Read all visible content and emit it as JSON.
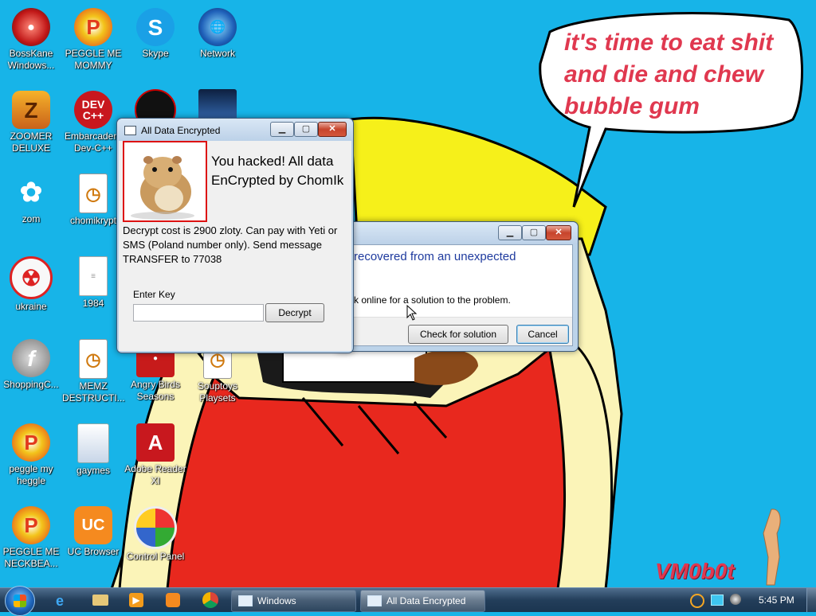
{
  "desktop": {
    "icons": [
      {
        "label": "BossKane Windows...",
        "icon": "bosskane-icon"
      },
      {
        "label": "PEGGLE ME MOMMY",
        "icon": "peggle-icon"
      },
      {
        "label": "Skype",
        "icon": "skype-icon"
      },
      {
        "label": "Network",
        "icon": "network-icon"
      },
      {
        "label": "ZOOMER DELUXE",
        "icon": "zoomer-icon"
      },
      {
        "label": "Embarcadero Dev-C++",
        "icon": "devcpp-icon"
      },
      {
        "label": "zom",
        "icon": "flower-icon"
      },
      {
        "label": "chomikrypt",
        "icon": "lock-file-icon"
      },
      {
        "label": "ukraine",
        "icon": "radiation-icon"
      },
      {
        "label": "1984",
        "icon": "text-file-icon"
      },
      {
        "label": "ShoppingC...",
        "icon": "flash-icon"
      },
      {
        "label": "MEMZ DESTRUCTI...",
        "icon": "lock-file-icon"
      },
      {
        "label": "Angry Birds Seasons",
        "icon": "angry-birds-icon"
      },
      {
        "label": "Souptoys Playsets",
        "icon": "lock-file-icon"
      },
      {
        "label": "peggle my heggle",
        "icon": "peggle-icon"
      },
      {
        "label": "gaymes",
        "icon": "folder-icon"
      },
      {
        "label": "Adobe Reader XI",
        "icon": "adobe-reader-icon"
      },
      {
        "label": "PEGGLE ME NECKBEA...",
        "icon": "peggle-icon"
      },
      {
        "label": "UC Browser",
        "icon": "uc-browser-icon"
      },
      {
        "label": "Control Panel",
        "icon": "control-panel-icon"
      }
    ]
  },
  "wallpaper": {
    "speech_bubble": "it's time to eat shit and die and chew bubble gum",
    "signature": "VM0b0t"
  },
  "ransom_window": {
    "title": "All Data Encrypted",
    "headline": "You hacked! All data EnCrypted by ChomIk",
    "message": "Decrypt cost is 2900 zloty. Can pay with Yeti or SMS (Poland number only). Send message TRANSFER to 77038",
    "key_label": "Enter Key",
    "key_value": "",
    "decrypt_label": "Decrypt",
    "image_icon": "hamster-icon"
  },
  "error_dialog": {
    "message": "recovered from an unexpected",
    "detail": "k online for a solution to the problem.",
    "check_label": "Check for solution",
    "cancel_label": "Cancel"
  },
  "taskbar": {
    "tasks": [
      {
        "label": "Windows",
        "active": false
      },
      {
        "label": "All Data Encrypted",
        "active": true
      }
    ],
    "clock": "5:45 PM"
  },
  "colors": {
    "desktop_bg": "#17b4e8",
    "bubble_text": "#e0384f",
    "dialog_link_text": "#1e3a9e"
  }
}
